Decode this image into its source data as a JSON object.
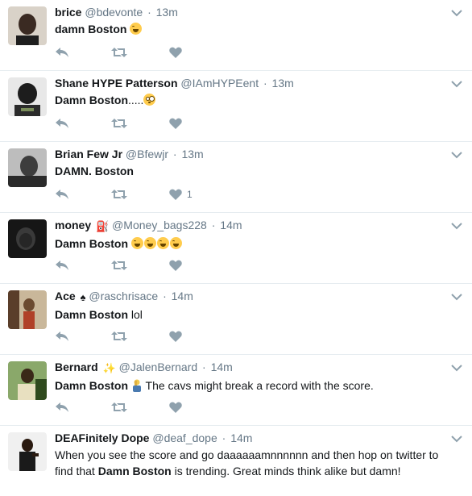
{
  "tweets": [
    {
      "fullname": "brice",
      "badge": "",
      "username": "@bdevonte",
      "time": "13m",
      "text_bold": "damn Boston",
      "text_rest": "",
      "emojis": [
        "laugh"
      ],
      "like_count": "",
      "avatar_color": "#3a2a22"
    },
    {
      "fullname": "Shane HYPE Patterson",
      "badge": "",
      "username": "@IAmHYPEent",
      "time": "13m",
      "text_bold": "Damn Boston",
      "text_rest": ".....",
      "emojis": [
        "flushed"
      ],
      "like_count": "",
      "avatar_color": "#1d1d1d"
    },
    {
      "fullname": "Brian Few Jr",
      "badge": "",
      "username": "@Bfewjr",
      "time": "13m",
      "text_bold": "DAMN. Boston",
      "text_rest": "",
      "emojis": [],
      "like_count": "1",
      "avatar_color": "#555555"
    },
    {
      "fullname": "money",
      "badge": "⛽",
      "username": "@Money_bags228",
      "time": "14m",
      "text_bold": "Damn Boston",
      "text_rest": "",
      "emojis": [
        "laugh",
        "laugh",
        "laugh",
        "laugh"
      ],
      "like_count": "",
      "avatar_color": "#262626"
    },
    {
      "fullname": "Ace",
      "badge": "♠",
      "username": "@raschrisace",
      "time": "14m",
      "text_bold": "Damn Boston",
      "text_rest": "lol",
      "emojis": [],
      "like_count": "",
      "avatar_color": "#7a4a2a"
    },
    {
      "fullname": "Bernard",
      "badge": "✨",
      "username": "@JalenBernard",
      "time": "14m",
      "text_bold": "Damn Boston",
      "text_rest": "The cavs might break a record with the score.",
      "emojis": [
        "facepalm"
      ],
      "like_count": "",
      "avatar_color": "#4a6a2a"
    },
    {
      "fullname": "DEAFinitely Dope",
      "badge": "",
      "username": "@deaf_dope",
      "time": "14m",
      "text_before": "When you see the score and go daaaaaamnnnnnn and then hop on twitter to find that",
      "text_bold": "Damn Boston",
      "text_rest": "is trending. Great minds think alike but damn!",
      "emojis": [],
      "like_count": "",
      "avatar_color": "#2a2a2a"
    }
  ],
  "separator": "·",
  "icons": {
    "reply": "reply-icon",
    "retweet": "retweet-icon",
    "like": "heart-icon",
    "more": "chevron-down-icon"
  },
  "colors": {
    "action_gray": "#8fa1ad",
    "meta_gray": "#657786",
    "divider": "#e6ecf0"
  }
}
